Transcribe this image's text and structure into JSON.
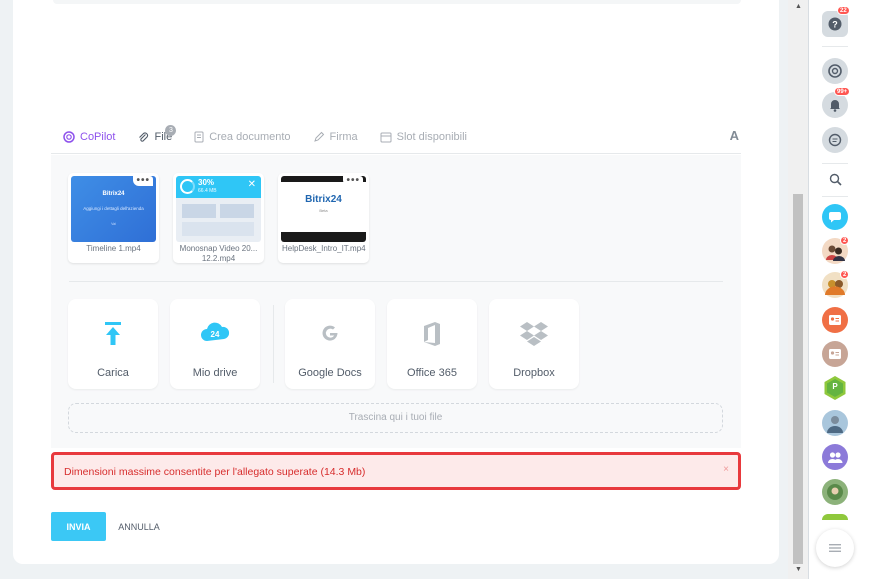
{
  "toolbar": {
    "copilot": "CoPilot",
    "file": "File",
    "file_count": "3",
    "create_doc": "Crea documento",
    "sign": "Firma",
    "slots": "Slot disponibili",
    "format": "A"
  },
  "attachments": [
    {
      "name": "Timeline 1.mp4",
      "preview_title": "Bitrix24",
      "preview_text": "Aggiungi i dettagli dell'azienda",
      "preview_small": "Vai"
    },
    {
      "name": "Monosnap Video 20... 12.2.mp4",
      "progress_label": "30%",
      "progress_value": 0.3,
      "size": "66.4 MB"
    },
    {
      "name": "HelpDesk_Intro_IT.mp4",
      "preview_title": "Bitrix24",
      "preview_small": "Beta"
    }
  ],
  "sources": [
    {
      "label": "Carica",
      "icon": "upload-icon"
    },
    {
      "label": "Mio drive",
      "icon": "cloud-24-icon"
    },
    {
      "label": "Google Docs",
      "icon": "google-icon"
    },
    {
      "label": "Office 365",
      "icon": "office-icon"
    },
    {
      "label": "Dropbox",
      "icon": "dropbox-icon"
    }
  ],
  "dropzone": "Trascina qui i tuoi file",
  "alert": {
    "message": "Dimensioni massime consentite per l'allegato superate (14.3 Mb)",
    "close": "×"
  },
  "buttons": {
    "send": "INVIA",
    "cancel": "ANNULLA"
  },
  "rightbar": {
    "help_badge": "22",
    "notif_badge": "99+",
    "avatar1_badge": "2",
    "avatar2_badge": "2",
    "group_letter": "P"
  },
  "colors": {
    "accent": "#3bc8f5",
    "copilot": "#8e52ec",
    "error": "#e8393d",
    "badge": "#ff5752"
  }
}
